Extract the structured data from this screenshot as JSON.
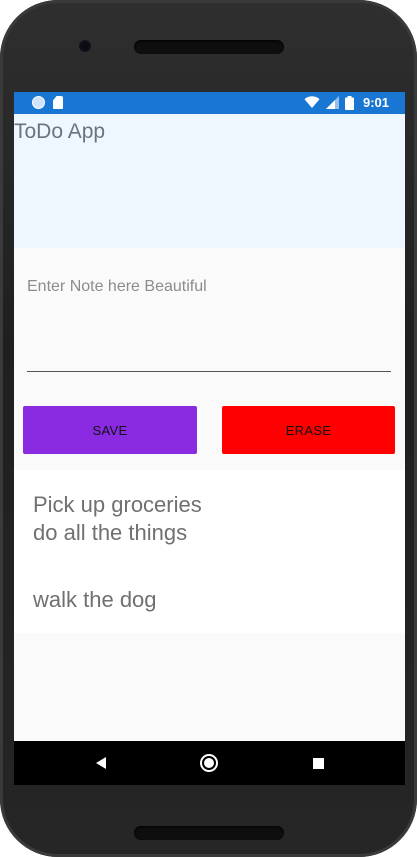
{
  "status_bar": {
    "time": "9:01",
    "icons": [
      "sync-circle-icon",
      "sd-card-icon",
      "wifi-icon",
      "signal-icon",
      "battery-icon"
    ]
  },
  "app": {
    "title": "ToDo App"
  },
  "note_input": {
    "placeholder": "Enter Note here Beautiful",
    "value": ""
  },
  "buttons": {
    "save_label": "SAVE",
    "erase_label": "ERASE"
  },
  "notes": [
    {
      "text": "Pick up groceries\ndo all the things"
    },
    {
      "text": "walk the dog"
    }
  ],
  "nav_bar": {
    "icons": [
      "back-icon",
      "home-icon",
      "recents-icon"
    ]
  },
  "colors": {
    "status_bar": "#1976d2",
    "header_bg": "#eef6ff",
    "save_button": "#8a2be2",
    "erase_button": "#ff0000"
  }
}
